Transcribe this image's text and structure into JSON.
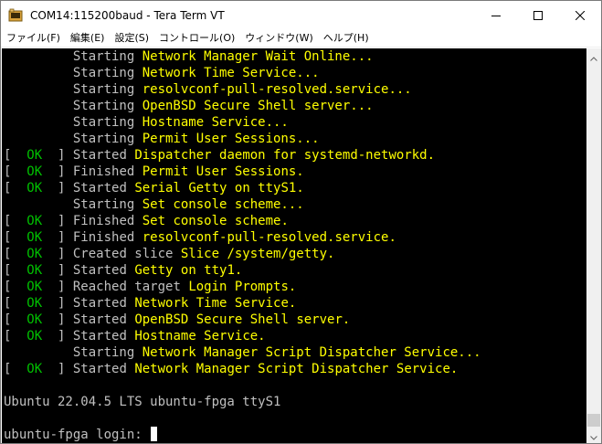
{
  "window": {
    "title": "COM14:115200baud - Tera Term VT",
    "icon": "tera-term-icon",
    "controls": [
      "minimize-icon",
      "maximize-icon",
      "close-icon"
    ]
  },
  "menu": {
    "items": [
      {
        "id": "file",
        "label": "ファイル(F)"
      },
      {
        "id": "edit",
        "label": "編集(E)"
      },
      {
        "id": "setup",
        "label": "設定(S)"
      },
      {
        "id": "control",
        "label": "コントロール(O)"
      },
      {
        "id": "window",
        "label": "ウィンドウ(W)"
      },
      {
        "id": "help",
        "label": "ヘルプ(H)"
      }
    ]
  },
  "colors": {
    "terminal_bg": "#000000",
    "text_default": "#c0c0c0",
    "text_highlight": "#ffff00",
    "text_ok": "#00c000"
  },
  "terminal": {
    "lines": [
      [
        {
          "t": "         Starting ",
          "c": "w"
        },
        {
          "t": "Network Manager Wait Online...",
          "c": "y"
        }
      ],
      [
        {
          "t": "         Starting ",
          "c": "w"
        },
        {
          "t": "Network Time Service...",
          "c": "y"
        }
      ],
      [
        {
          "t": "         Starting ",
          "c": "w"
        },
        {
          "t": "resolvconf-pull-resolved.service...",
          "c": "y"
        }
      ],
      [
        {
          "t": "         Starting ",
          "c": "w"
        },
        {
          "t": "OpenBSD Secure Shell server...",
          "c": "y"
        }
      ],
      [
        {
          "t": "         Starting ",
          "c": "w"
        },
        {
          "t": "Hostname Service...",
          "c": "y"
        }
      ],
      [
        {
          "t": "         Starting ",
          "c": "w"
        },
        {
          "t": "Permit User Sessions...",
          "c": "y"
        }
      ],
      [
        {
          "t": "[  ",
          "c": "w"
        },
        {
          "t": "OK",
          "c": "g"
        },
        {
          "t": "  ] Started ",
          "c": "w"
        },
        {
          "t": "Dispatcher daemon for systemd-networkd.",
          "c": "y"
        }
      ],
      [
        {
          "t": "[  ",
          "c": "w"
        },
        {
          "t": "OK",
          "c": "g"
        },
        {
          "t": "  ] Finished ",
          "c": "w"
        },
        {
          "t": "Permit User Sessions.",
          "c": "y"
        }
      ],
      [
        {
          "t": "[  ",
          "c": "w"
        },
        {
          "t": "OK",
          "c": "g"
        },
        {
          "t": "  ] Started ",
          "c": "w"
        },
        {
          "t": "Serial Getty on ttyS1.",
          "c": "y"
        }
      ],
      [
        {
          "t": "         Starting ",
          "c": "w"
        },
        {
          "t": "Set console scheme...",
          "c": "y"
        }
      ],
      [
        {
          "t": "[  ",
          "c": "w"
        },
        {
          "t": "OK",
          "c": "g"
        },
        {
          "t": "  ] Finished ",
          "c": "w"
        },
        {
          "t": "Set console scheme.",
          "c": "y"
        }
      ],
      [
        {
          "t": "[  ",
          "c": "w"
        },
        {
          "t": "OK",
          "c": "g"
        },
        {
          "t": "  ] Finished ",
          "c": "w"
        },
        {
          "t": "resolvconf-pull-resolved.service.",
          "c": "y"
        }
      ],
      [
        {
          "t": "[  ",
          "c": "w"
        },
        {
          "t": "OK",
          "c": "g"
        },
        {
          "t": "  ] Created slice ",
          "c": "w"
        },
        {
          "t": "Slice /system/getty.",
          "c": "y"
        }
      ],
      [
        {
          "t": "[  ",
          "c": "w"
        },
        {
          "t": "OK",
          "c": "g"
        },
        {
          "t": "  ] Started ",
          "c": "w"
        },
        {
          "t": "Getty on tty1.",
          "c": "y"
        }
      ],
      [
        {
          "t": "[  ",
          "c": "w"
        },
        {
          "t": "OK",
          "c": "g"
        },
        {
          "t": "  ] Reached target ",
          "c": "w"
        },
        {
          "t": "Login Prompts.",
          "c": "y"
        }
      ],
      [
        {
          "t": "[  ",
          "c": "w"
        },
        {
          "t": "OK",
          "c": "g"
        },
        {
          "t": "  ] Started ",
          "c": "w"
        },
        {
          "t": "Network Time Service.",
          "c": "y"
        }
      ],
      [
        {
          "t": "[  ",
          "c": "w"
        },
        {
          "t": "OK",
          "c": "g"
        },
        {
          "t": "  ] Started ",
          "c": "w"
        },
        {
          "t": "OpenBSD Secure Shell server.",
          "c": "y"
        }
      ],
      [
        {
          "t": "[  ",
          "c": "w"
        },
        {
          "t": "OK",
          "c": "g"
        },
        {
          "t": "  ] Started ",
          "c": "w"
        },
        {
          "t": "Hostname Service.",
          "c": "y"
        }
      ],
      [
        {
          "t": "         Starting ",
          "c": "w"
        },
        {
          "t": "Network Manager Script Dispatcher Service...",
          "c": "y"
        }
      ],
      [
        {
          "t": "[  ",
          "c": "w"
        },
        {
          "t": "OK",
          "c": "g"
        },
        {
          "t": "  ] Started ",
          "c": "w"
        },
        {
          "t": "Network Manager Script Dispatcher Service.",
          "c": "y"
        }
      ],
      [
        {
          "t": "",
          "c": "w"
        }
      ],
      [
        {
          "t": "Ubuntu 22.04.5 LTS ubuntu-fpga ttyS1",
          "c": "w"
        }
      ],
      [
        {
          "t": "",
          "c": "w"
        }
      ],
      [
        {
          "t": "ubuntu-fpga login: ",
          "c": "w"
        }
      ]
    ],
    "prompt_line_index": 23
  }
}
